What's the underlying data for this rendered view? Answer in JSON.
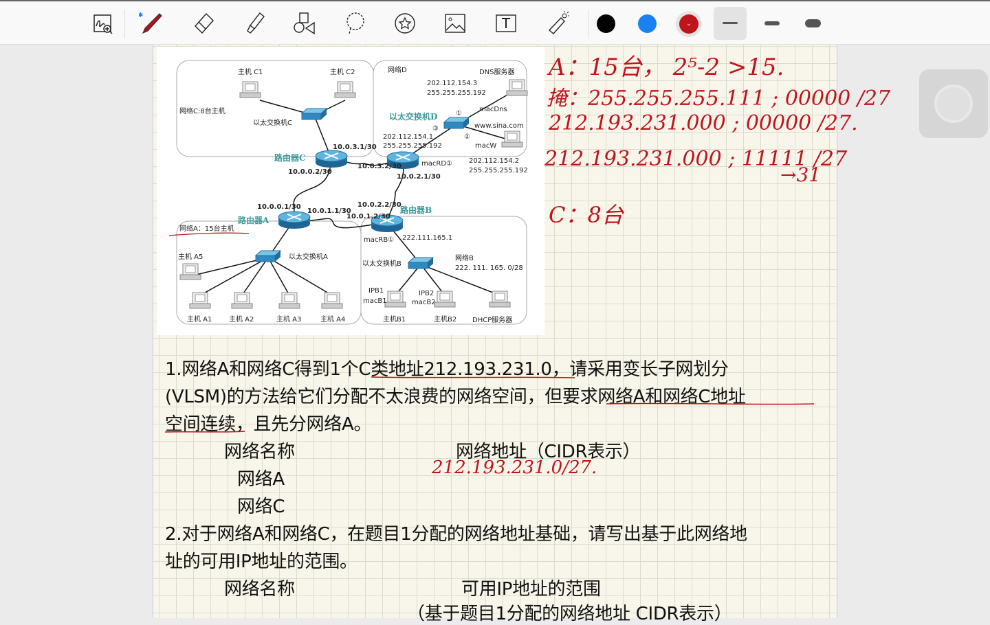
{
  "toolbar": {
    "tools": [
      "lasso-zoom",
      "pen",
      "eraser",
      "highlighter",
      "shapes",
      "lasso",
      "sticker",
      "image",
      "text",
      "laser-pointer"
    ],
    "colors": [
      "#000000",
      "#1a82f0",
      "#c0141c"
    ],
    "selected_color": "#c0141c",
    "stroke_widths": [
      "thin",
      "medium",
      "thick"
    ],
    "selected_width": "thin"
  },
  "diagram": {
    "net_c": "网络C:8台主机",
    "host_c1": "主机 C1",
    "host_c2": "主机 C2",
    "switch_c": "以太交换机C",
    "net_d": "网络D",
    "dns": "DNS服务器",
    "dns_ip": "202.112.154.3",
    "dns_mask": "255.255.255.192",
    "mac_dns": "macDns",
    "switch_d": "以太交换机D",
    "p1": "①",
    "p2": "②",
    "p3": "③",
    "www": "www.sina.com",
    "mac_w": "macW",
    "rd_ip": "202.112.154.1",
    "rd_mask": "255.255.255.192",
    "w_ip": "202.112.154.2",
    "w_mask": "255.255.255.192",
    "router_c": "路由器C",
    "rc_ip1": "10.0.3.1/30",
    "rc_ip2": "10.0.0.2/30",
    "rd_ip1": "10.0.3.2/30",
    "mac_rd": "macRD①",
    "rd_ip2": "10.0.2.1/30",
    "router_a": "路由器A",
    "ra_ip1": "10.0.0.1/30",
    "ra_ip2": "10.0.1.1/30",
    "net_a": "网络A：15台主机",
    "router_b": "路由器B",
    "rb_ip1": "10.0.2.2/30",
    "rb_ip2": "10.0.1.2/30",
    "mac_rb": "macRB①",
    "rb_ip3": "222.111.165.1",
    "switch_a": "以太交换机A",
    "host_a5": "主机 A5",
    "host_a1": "主机 A1",
    "host_a2": "主机 A2",
    "host_a3": "主机 A3",
    "host_a4": "主机 A4",
    "switch_b": "以太交换机B",
    "net_b": "网络B",
    "net_b_addr": "222. 111. 165. 0/28",
    "ipb1": "IPB1",
    "macb1": "macB1",
    "ipb2": "IPB2",
    "macb2": "macB2",
    "host_b1": "主机B1",
    "host_b2": "主机B2",
    "dhcp": "DHCP服务器"
  },
  "question": {
    "l1": "1.网络A和网络C得到1个C类地址212.193.231.0，请采用变长子网划分",
    "l2": "(VLSM)的方法给它们分配不太浪费的网络空间，但要求网络A和网络C地址",
    "l3": "空间连续，且先分网络A。",
    "col1": "网络名称",
    "col2": "网络地址（CIDR表示）",
    "row_a": "网络A",
    "row_c": "网络C",
    "l4": "2.对于网络A和网络C，在题目1分配的网络地址基础，请写出基于此网络地",
    "l5": "址的可用IP地址的范围。",
    "col3": "网络名称",
    "col4": "可用IP地址的范围",
    "col4b": "（基于题目1分配的网络地址 CIDR表示）"
  },
  "handwriting": {
    "h1": "A：15台，  2⁵-2 >15.",
    "h2": "掩：255.255.255.111 ; 00000 /27",
    "h3": "212.193.231.000 ; 00000 /27.",
    "h4": "212.193.231.000 ; 11111 /27",
    "h5": "→31",
    "h6": "C：8台",
    "h7": "212.193.231.0/27."
  }
}
